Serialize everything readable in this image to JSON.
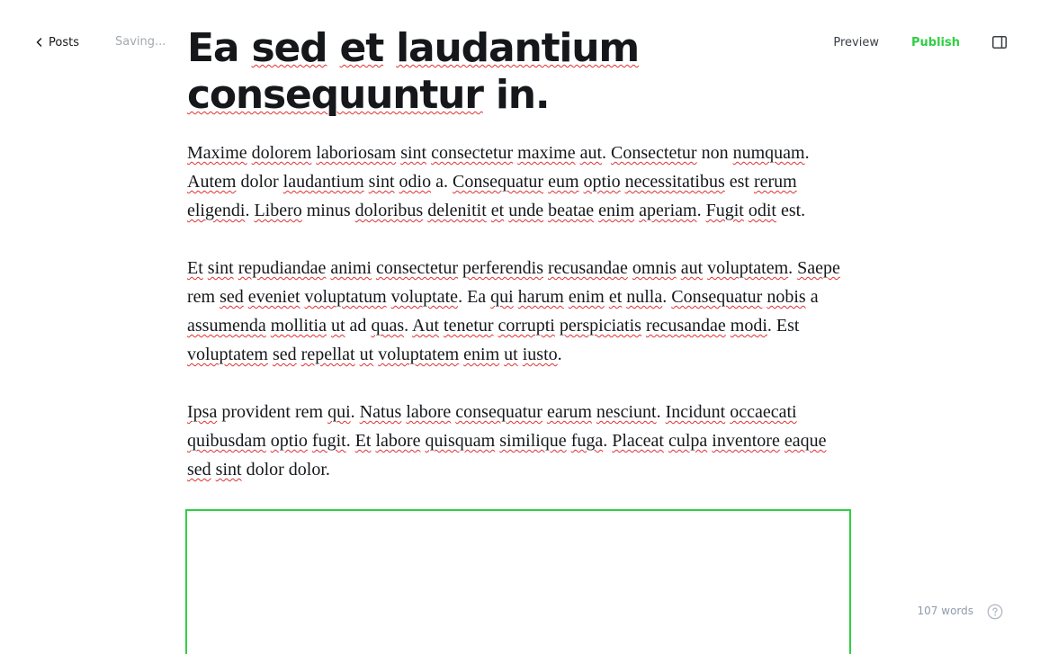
{
  "topbar": {
    "back_label": "Posts",
    "status_text": "Saving...",
    "preview_label": "Preview",
    "publish_label": "Publish",
    "sidebar_toggle_icon": "sidebar-panel-icon",
    "accent_color": "#30cf43"
  },
  "post": {
    "title_words": [
      "Ea",
      "sed",
      "et",
      "laudantium",
      "consequuntur",
      "in."
    ],
    "title_misspelled": [
      false,
      true,
      true,
      true,
      true,
      false
    ],
    "paragraphs": [
      [
        [
          "Maxime",
          true
        ],
        [
          "dolorem",
          true
        ],
        [
          "laboriosam",
          true
        ],
        [
          "sint",
          true
        ],
        [
          "consectetur",
          true
        ],
        [
          "maxime",
          true
        ],
        [
          "aut",
          true
        ],
        [
          "."
        ],
        [
          "Consectetur",
          true
        ],
        [
          "non"
        ],
        [
          "numquam",
          true
        ],
        [
          "."
        ],
        [
          "Autem",
          true
        ],
        [
          "dolor"
        ],
        [
          "laudantium",
          true
        ],
        [
          "sint",
          true
        ],
        [
          "odio",
          true
        ],
        [
          "a."
        ],
        [
          "Consequatur",
          true
        ],
        [
          "eum",
          true
        ],
        [
          "optio",
          true
        ],
        [
          "necessitatibus",
          true
        ],
        [
          "est"
        ],
        [
          "rerum",
          true
        ],
        [
          "eligendi",
          true
        ],
        [
          "."
        ],
        [
          "Libero",
          true
        ],
        [
          "minus"
        ],
        [
          "doloribus",
          true
        ],
        [
          "delenitit",
          true
        ],
        [
          "et",
          true
        ],
        [
          "unde",
          true
        ],
        [
          "beatae",
          true
        ],
        [
          "enim",
          true
        ],
        [
          "aperiam",
          true
        ],
        [
          "."
        ],
        [
          "Fugit",
          true
        ],
        [
          "odit",
          true
        ],
        [
          "est."
        ]
      ],
      [
        [
          "Et",
          true
        ],
        [
          "sint",
          true
        ],
        [
          "repudiandae",
          true
        ],
        [
          "animi",
          true
        ],
        [
          "consectetur",
          true
        ],
        [
          "perferendis",
          true
        ],
        [
          "recusandae",
          true
        ],
        [
          "omnis",
          true
        ],
        [
          "aut",
          true
        ],
        [
          "voluptatem",
          true
        ],
        [
          "."
        ],
        [
          "Saepe",
          true
        ],
        [
          "rem"
        ],
        [
          "sed",
          true
        ],
        [
          "eveniet",
          true
        ],
        [
          "voluptatum",
          true
        ],
        [
          "voluptate",
          true
        ],
        [
          ". Ea"
        ],
        [
          "qui",
          true
        ],
        [
          "harum",
          true
        ],
        [
          "enim",
          true
        ],
        [
          "et",
          true
        ],
        [
          "nulla",
          true
        ],
        [
          "."
        ],
        [
          "Consequatur",
          true
        ],
        [
          "nobis",
          true
        ],
        [
          "a"
        ],
        [
          "assumenda",
          true
        ],
        [
          "mollitia",
          true
        ],
        [
          "ut",
          true
        ],
        [
          "ad"
        ],
        [
          "quas",
          true
        ],
        [
          "."
        ],
        [
          "Aut",
          true
        ],
        [
          "tenetur",
          true
        ],
        [
          "corrupti",
          true
        ],
        [
          "perspiciatis",
          true
        ],
        [
          "recusandae",
          true
        ],
        [
          "modi",
          true
        ],
        [
          ". Est"
        ],
        [
          "voluptatem",
          true
        ],
        [
          "sed",
          true
        ],
        [
          "repellat",
          true
        ],
        [
          "ut",
          true
        ],
        [
          "voluptatem",
          true
        ],
        [
          "enim",
          true
        ],
        [
          "ut",
          true
        ],
        [
          "iusto",
          true
        ],
        [
          "."
        ]
      ],
      [
        [
          "Ipsa",
          true
        ],
        [
          "provident rem"
        ],
        [
          "qui",
          true
        ],
        [
          "."
        ],
        [
          "Natus",
          true
        ],
        [
          "labore",
          true
        ],
        [
          "consequatur",
          true
        ],
        [
          "earum",
          true
        ],
        [
          "nesciunt",
          true
        ],
        [
          "."
        ],
        [
          "Incidunt",
          true
        ],
        [
          "occaecati",
          true
        ],
        [
          "quibusdam",
          true
        ],
        [
          "optio",
          true
        ],
        [
          "fugit",
          true
        ],
        [
          "."
        ],
        [
          "Et",
          true
        ],
        [
          "labore",
          true
        ],
        [
          "quisquam",
          true
        ],
        [
          "similique",
          true
        ],
        [
          "fuga",
          true
        ],
        [
          "."
        ],
        [
          "Placeat",
          true
        ],
        [
          "culpa",
          true
        ],
        [
          "inventore",
          true
        ],
        [
          "eaque",
          true
        ],
        [
          "sed",
          true
        ],
        [
          "sint",
          true
        ],
        [
          "dolor dolor."
        ]
      ]
    ]
  },
  "footer": {
    "word_count": "107 words",
    "help_icon": "help-circle-icon"
  }
}
